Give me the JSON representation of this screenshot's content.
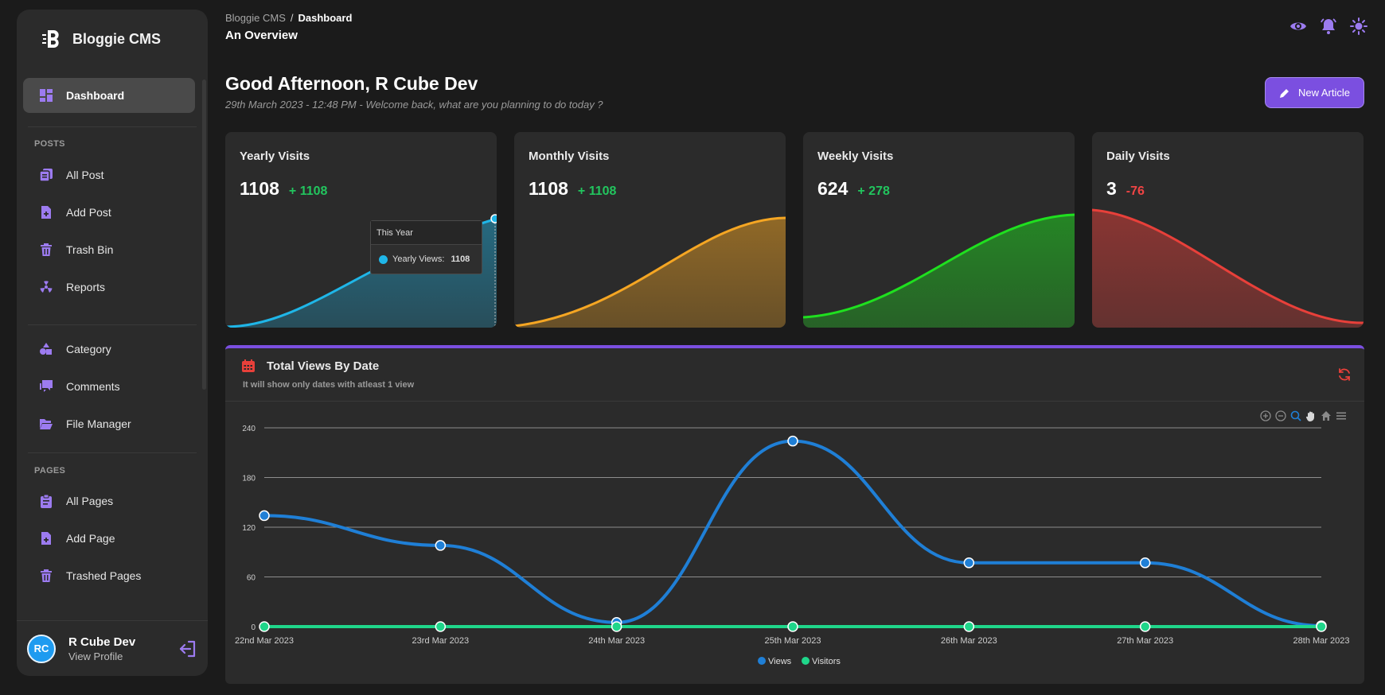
{
  "brand": {
    "name": "Bloggie CMS"
  },
  "sidebar": {
    "dashboard": "Dashboard",
    "posts_label": "POSTS",
    "all_post": "All Post",
    "add_post": "Add Post",
    "trash_bin": "Trash Bin",
    "reports": "Reports",
    "category": "Category",
    "comments": "Comments",
    "file_manager": "File Manager",
    "pages_label": "PAGES",
    "all_pages": "All Pages",
    "add_page": "Add Page",
    "trashed_pages": "Trashed Pages"
  },
  "profile": {
    "initials": "RC",
    "name": "R Cube Dev",
    "link": "View Profile"
  },
  "header": {
    "breadcrumb_root": "Bloggie CMS",
    "breadcrumb_sep": "/",
    "breadcrumb_current": "Dashboard",
    "subtitle": "An Overview",
    "greeting": "Good Afternoon, R Cube Dev",
    "subline": "29th March 2023 - 12:48 PM - Welcome back, what are you planning to do today ?",
    "new_article": "New Article"
  },
  "cards": [
    {
      "title": "Yearly Visits",
      "value": "1108",
      "delta": "+ 1108",
      "color": "#1fb6e8"
    },
    {
      "title": "Monthly Visits",
      "value": "1108",
      "delta": "+ 1108",
      "color": "#f5a623"
    },
    {
      "title": "Weekly Visits",
      "value": "624",
      "delta": "+ 278",
      "color": "#1fe01f"
    },
    {
      "title": "Daily Visits",
      "value": "3",
      "delta": "-76",
      "color": "#e8403a"
    }
  ],
  "tooltip": {
    "title": "This Year",
    "label": "Yearly Views:",
    "value": "1108"
  },
  "panel": {
    "title": "Total Views By Date",
    "subtitle": "It will show only dates with atleast 1 view"
  },
  "colors": {
    "accent": "#7b4fe0",
    "positive": "#22c55e",
    "negative": "#ef4444",
    "views": "#1f7fd6",
    "visitors": "#1fd68a"
  },
  "chart_data": {
    "type": "line",
    "x": [
      "22nd Mar 2023",
      "23rd Mar 2023",
      "24th Mar 2023",
      "25th Mar 2023",
      "26th Mar 2023",
      "27th Mar 2023",
      "28th Mar 2023"
    ],
    "yticks": [
      "240",
      "180",
      "120",
      "60",
      "0"
    ],
    "ylim": [
      0,
      240
    ],
    "series": [
      {
        "name": "Views",
        "values": [
          134,
          98,
          5,
          224,
          77,
          77,
          1
        ]
      },
      {
        "name": "Visitors",
        "values": [
          0,
          0,
          0,
          0,
          0,
          0,
          0
        ]
      }
    ],
    "grid": true,
    "legend": "bottom-center"
  }
}
